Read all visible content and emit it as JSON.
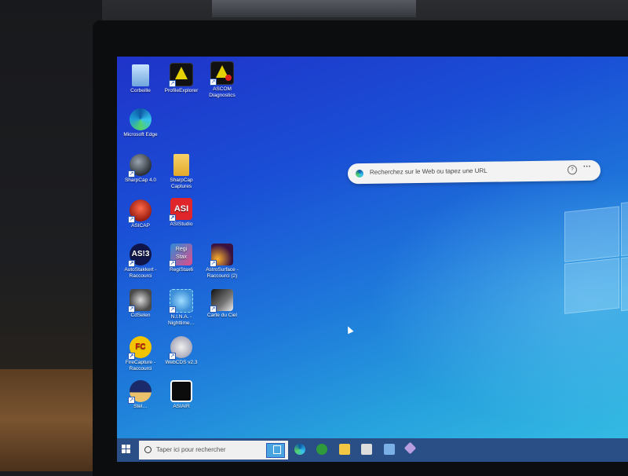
{
  "desktop": {
    "icons": [
      {
        "label": "Corbeille",
        "icon": "recycle-bin-icon"
      },
      {
        "label": "ProfileExplorer",
        "icon": "ascom-profile-icon"
      },
      {
        "label": "ASCOM Diagnostics",
        "icon": "ascom-diagnostics-icon"
      },
      {
        "label": "Microsoft Edge",
        "icon": "edge-icon"
      },
      {
        "label": "SharpCap 4.0",
        "icon": "sharpcap-icon"
      },
      {
        "label": "SharpCap Captures",
        "icon": "folder-icon"
      },
      {
        "label": "ASICAP",
        "icon": "asicap-icon"
      },
      {
        "label": "ASIStudio",
        "icon": "asistudio-icon",
        "glyph": "ASI"
      },
      {
        "label": "AutoStakkert - Raccourci",
        "icon": "autostakkert-icon",
        "glyph": "AS!3"
      },
      {
        "label": "RegiStax6",
        "icon": "registax-icon",
        "glyph": "Regi Stax"
      },
      {
        "label": "AstroSurface - Raccourci (2)",
        "icon": "astrosurface-icon"
      },
      {
        "label": "CdSelen",
        "icon": "cdselen-icon"
      },
      {
        "label": "N.I.N.A. - Nighttime…",
        "icon": "nina-icon"
      },
      {
        "label": "Carte du Ciel",
        "icon": "carte-du-ciel-icon"
      },
      {
        "label": "FireCapture - Raccourci",
        "icon": "firecapture-icon",
        "glyph": "FC"
      },
      {
        "label": "WebCDS v2.3",
        "icon": "webcds-icon"
      },
      {
        "label": "Stel…",
        "icon": "stellarium-icon"
      },
      {
        "label": "ASIAIR",
        "icon": "asiair-icon"
      }
    ]
  },
  "search_widget": {
    "placeholder": "Recherchez sur le Web ou tapez une URL",
    "mic_glyph": "?",
    "more_glyph": "···"
  },
  "taskbar": {
    "search_placeholder": "Taper ici pour rechercher",
    "start_icon": "windows-logo-icon"
  }
}
